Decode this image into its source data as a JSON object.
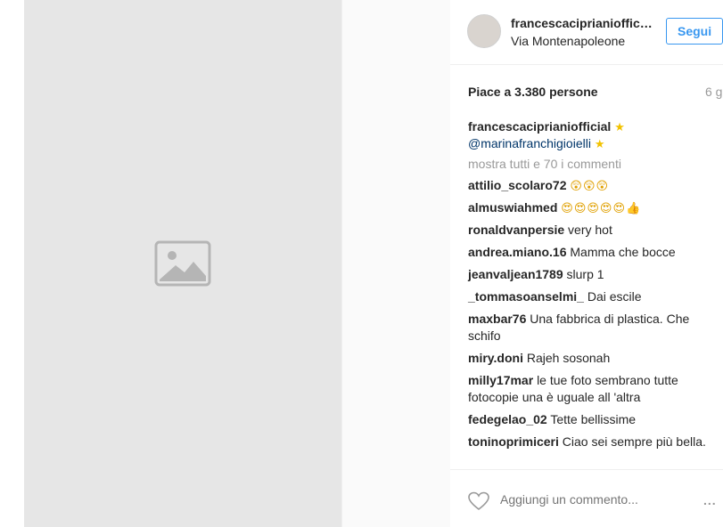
{
  "post": {
    "username": "francescaciprianioffic…",
    "location": "Via Montenapoleone",
    "follow_label": "Segui",
    "likes": "Piace a 3.380 persone",
    "time": "6 g",
    "caption": {
      "user": "francescaciprianiofficial",
      "star1": "★",
      "mention": "@marinafranchigioielli",
      "star2": "★"
    },
    "more_comments": "mostra tutti e 70 i commenti"
  },
  "comments": [
    {
      "user": "attilio_scolaro72",
      "text": "",
      "emoji": "😲😲😲"
    },
    {
      "user": "almuswiahmed",
      "text": "",
      "emoji": "😍😍😍😍😍👍"
    },
    {
      "user": "ronaldvanpersie",
      "text": "very hot",
      "emoji": ""
    },
    {
      "user": "andrea.miano.16",
      "text": "Mamma che bocce",
      "emoji": ""
    },
    {
      "user": "jeanvaljean1789",
      "text": "slurp 1",
      "emoji": ""
    },
    {
      "user": "_tommasoanselmi_",
      "text": "Dai escile",
      "emoji": ""
    },
    {
      "user": "maxbar76",
      "text": "Una fabbrica di plastica. Che schifo",
      "emoji": ""
    },
    {
      "user": "miry.doni",
      "text": "Rajeh sosonah",
      "emoji": ""
    },
    {
      "user": "milly17mar",
      "text": "le tue foto sembrano tutte fotocopie una è uguale all 'altra",
      "emoji": ""
    },
    {
      "user": "fedegelao_02",
      "text": "Tette bellissime",
      "emoji": ""
    },
    {
      "user": "toninoprimiceri",
      "text": "Ciao sei sempre più bella.",
      "emoji": ""
    }
  ],
  "comment_bar": {
    "placeholder": "Aggiungi un commento...",
    "more": "..."
  },
  "colors": {
    "accent": "#3897f0",
    "text": "#262626",
    "muted": "#999999"
  },
  "icons": [
    "image-placeholder-icon",
    "heart-icon",
    "more-options-icon"
  ]
}
